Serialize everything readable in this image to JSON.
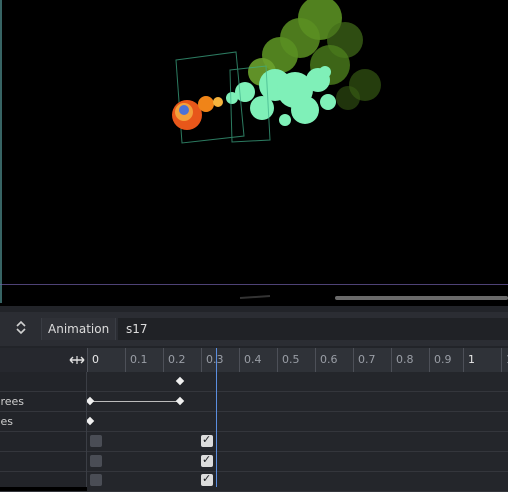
{
  "animation_bar": {
    "label": "Animation",
    "name": "s17"
  },
  "ruler": {
    "ticks": [
      "0",
      "0.1",
      "0.2",
      "0.3",
      "0.4",
      "0.5",
      "0.6",
      "0.7",
      "0.8",
      "0.9",
      "1",
      "1"
    ]
  },
  "tracks": [
    {
      "label": ""
    },
    {
      "label": "rees"
    },
    {
      "label": "es"
    },
    {
      "label": ""
    },
    {
      "label": ""
    },
    {
      "label": ""
    }
  ],
  "checkboxes": [
    {
      "left": false,
      "right": true
    },
    {
      "left": false,
      "right": true
    },
    {
      "left": false,
      "right": true
    }
  ],
  "colors": {
    "playhead": "#5b8ee0",
    "foliage": "#5a8f22",
    "mist": "#7ff0b8",
    "ball": "#f06a1a"
  },
  "icons": [
    "up-down-arrows-icon",
    "zoom-horizontal-icon"
  ]
}
